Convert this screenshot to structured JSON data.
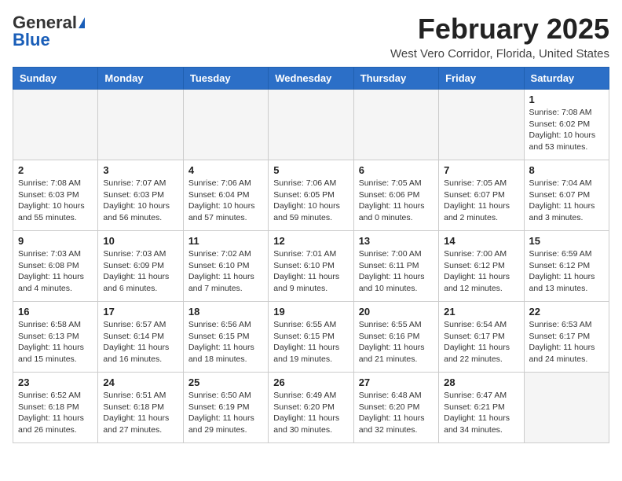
{
  "logo": {
    "line1": "General",
    "line2": "Blue"
  },
  "header": {
    "month": "February 2025",
    "location": "West Vero Corridor, Florida, United States"
  },
  "days_of_week": [
    "Sunday",
    "Monday",
    "Tuesday",
    "Wednesday",
    "Thursday",
    "Friday",
    "Saturday"
  ],
  "weeks": [
    [
      {
        "day": "",
        "info": ""
      },
      {
        "day": "",
        "info": ""
      },
      {
        "day": "",
        "info": ""
      },
      {
        "day": "",
        "info": ""
      },
      {
        "day": "",
        "info": ""
      },
      {
        "day": "",
        "info": ""
      },
      {
        "day": "1",
        "info": "Sunrise: 7:08 AM\nSunset: 6:02 PM\nDaylight: 10 hours and 53 minutes."
      }
    ],
    [
      {
        "day": "2",
        "info": "Sunrise: 7:08 AM\nSunset: 6:03 PM\nDaylight: 10 hours and 55 minutes."
      },
      {
        "day": "3",
        "info": "Sunrise: 7:07 AM\nSunset: 6:03 PM\nDaylight: 10 hours and 56 minutes."
      },
      {
        "day": "4",
        "info": "Sunrise: 7:06 AM\nSunset: 6:04 PM\nDaylight: 10 hours and 57 minutes."
      },
      {
        "day": "5",
        "info": "Sunrise: 7:06 AM\nSunset: 6:05 PM\nDaylight: 10 hours and 59 minutes."
      },
      {
        "day": "6",
        "info": "Sunrise: 7:05 AM\nSunset: 6:06 PM\nDaylight: 11 hours and 0 minutes."
      },
      {
        "day": "7",
        "info": "Sunrise: 7:05 AM\nSunset: 6:07 PM\nDaylight: 11 hours and 2 minutes."
      },
      {
        "day": "8",
        "info": "Sunrise: 7:04 AM\nSunset: 6:07 PM\nDaylight: 11 hours and 3 minutes."
      }
    ],
    [
      {
        "day": "9",
        "info": "Sunrise: 7:03 AM\nSunset: 6:08 PM\nDaylight: 11 hours and 4 minutes."
      },
      {
        "day": "10",
        "info": "Sunrise: 7:03 AM\nSunset: 6:09 PM\nDaylight: 11 hours and 6 minutes."
      },
      {
        "day": "11",
        "info": "Sunrise: 7:02 AM\nSunset: 6:10 PM\nDaylight: 11 hours and 7 minutes."
      },
      {
        "day": "12",
        "info": "Sunrise: 7:01 AM\nSunset: 6:10 PM\nDaylight: 11 hours and 9 minutes."
      },
      {
        "day": "13",
        "info": "Sunrise: 7:00 AM\nSunset: 6:11 PM\nDaylight: 11 hours and 10 minutes."
      },
      {
        "day": "14",
        "info": "Sunrise: 7:00 AM\nSunset: 6:12 PM\nDaylight: 11 hours and 12 minutes."
      },
      {
        "day": "15",
        "info": "Sunrise: 6:59 AM\nSunset: 6:12 PM\nDaylight: 11 hours and 13 minutes."
      }
    ],
    [
      {
        "day": "16",
        "info": "Sunrise: 6:58 AM\nSunset: 6:13 PM\nDaylight: 11 hours and 15 minutes."
      },
      {
        "day": "17",
        "info": "Sunrise: 6:57 AM\nSunset: 6:14 PM\nDaylight: 11 hours and 16 minutes."
      },
      {
        "day": "18",
        "info": "Sunrise: 6:56 AM\nSunset: 6:15 PM\nDaylight: 11 hours and 18 minutes."
      },
      {
        "day": "19",
        "info": "Sunrise: 6:55 AM\nSunset: 6:15 PM\nDaylight: 11 hours and 19 minutes."
      },
      {
        "day": "20",
        "info": "Sunrise: 6:55 AM\nSunset: 6:16 PM\nDaylight: 11 hours and 21 minutes."
      },
      {
        "day": "21",
        "info": "Sunrise: 6:54 AM\nSunset: 6:17 PM\nDaylight: 11 hours and 22 minutes."
      },
      {
        "day": "22",
        "info": "Sunrise: 6:53 AM\nSunset: 6:17 PM\nDaylight: 11 hours and 24 minutes."
      }
    ],
    [
      {
        "day": "23",
        "info": "Sunrise: 6:52 AM\nSunset: 6:18 PM\nDaylight: 11 hours and 26 minutes."
      },
      {
        "day": "24",
        "info": "Sunrise: 6:51 AM\nSunset: 6:18 PM\nDaylight: 11 hours and 27 minutes."
      },
      {
        "day": "25",
        "info": "Sunrise: 6:50 AM\nSunset: 6:19 PM\nDaylight: 11 hours and 29 minutes."
      },
      {
        "day": "26",
        "info": "Sunrise: 6:49 AM\nSunset: 6:20 PM\nDaylight: 11 hours and 30 minutes."
      },
      {
        "day": "27",
        "info": "Sunrise: 6:48 AM\nSunset: 6:20 PM\nDaylight: 11 hours and 32 minutes."
      },
      {
        "day": "28",
        "info": "Sunrise: 6:47 AM\nSunset: 6:21 PM\nDaylight: 11 hours and 34 minutes."
      },
      {
        "day": "",
        "info": ""
      }
    ]
  ]
}
